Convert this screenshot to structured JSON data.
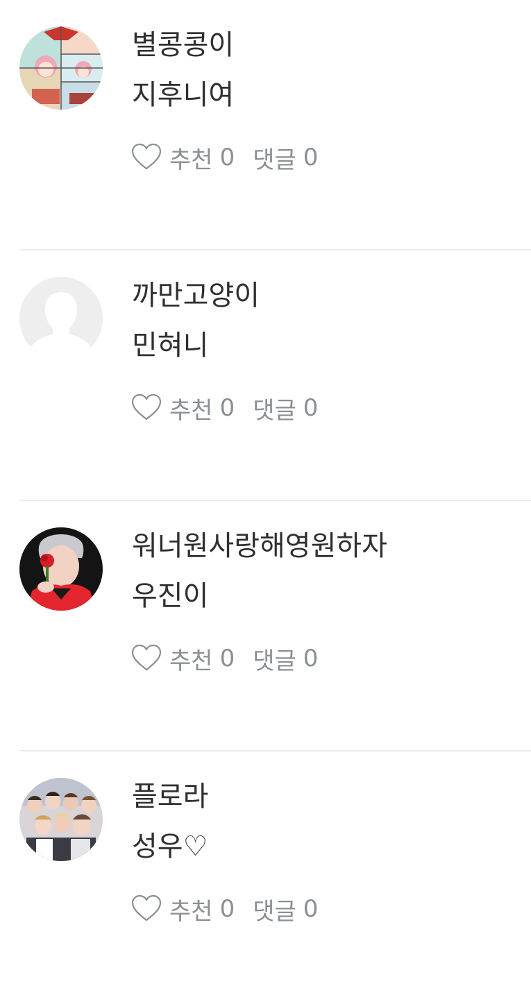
{
  "comments": [
    {
      "author": "별콩콩이",
      "text": "지후니여",
      "like_label": "추천",
      "like_count": "0",
      "reply_label": "댓글",
      "reply_count": "0",
      "avatar": "comic-avatar"
    },
    {
      "author": "까만고양이",
      "text": "민혀니",
      "like_label": "추천",
      "like_count": "0",
      "reply_label": "댓글",
      "reply_count": "0",
      "avatar": "default-avatar"
    },
    {
      "author": "워너원사랑해영원하자",
      "text": "우진이",
      "like_label": "추천",
      "like_count": "0",
      "reply_label": "댓글",
      "reply_count": "0",
      "avatar": "photo-avatar"
    },
    {
      "author": "플로라",
      "text": "성우♡",
      "like_label": "추천",
      "like_count": "0",
      "reply_label": "댓글",
      "reply_count": "0",
      "avatar": "group-photo-avatar"
    }
  ],
  "colors": {
    "text": "#2f2f2f",
    "muted": "#8a8f94",
    "divider": "#e8ebee"
  }
}
